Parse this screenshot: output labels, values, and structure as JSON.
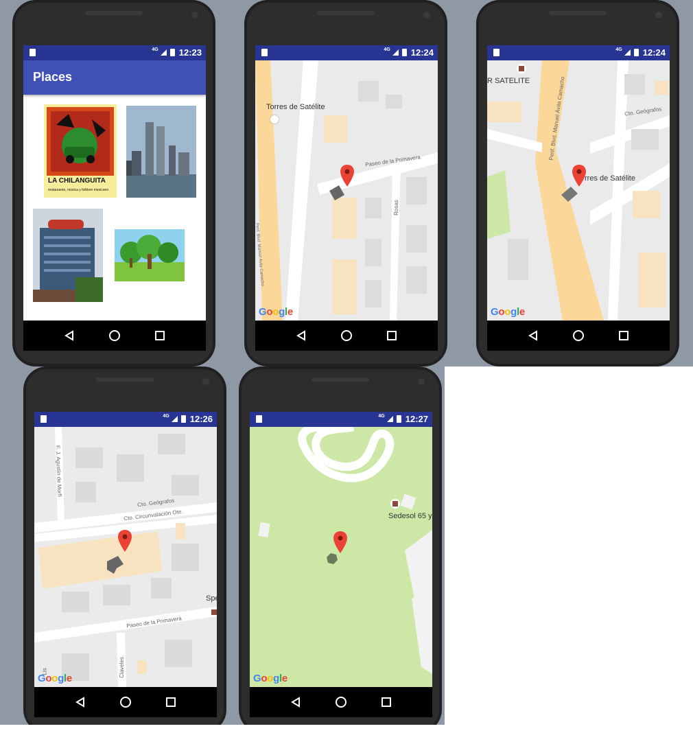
{
  "screens": [
    {
      "time": "12:23",
      "network": "4G",
      "app_title": "Places"
    },
    {
      "time": "12:24",
      "network": "4G",
      "map_labels": {
        "poi": "Torres de Satélite",
        "street1": "Paseo de la Primavera",
        "street2": "Rosas",
        "street3": "Perif. Blvd. Manuel Ávila Camacho"
      }
    },
    {
      "time": "12:24",
      "network": "4G",
      "map_labels": {
        "poi": "rres de Satélite",
        "poi2": "R SATELITE",
        "street1": "Perif. Blvd. Manuel Ávila Camacho",
        "street2": "Cto. Geógrafos"
      }
    },
    {
      "time": "12:26",
      "network": "4G",
      "map_labels": {
        "street1": "Cto. Geógrafos",
        "street2": "Cto. Circunvalación Ote.",
        "street3": "Paseo de la Primavera",
        "street4": "F. J. Agustín de Morfí",
        "street5": "Claveles",
        "street6": "Lis",
        "poi": "Spe"
      }
    },
    {
      "time": "12:27",
      "network": "4G",
      "map_labels": {
        "poi": "Sedesol 65 y"
      }
    }
  ],
  "thumbnails": {
    "logo_text": "LA CHILANGUITA",
    "logo_sub": "restaurante, música y folklore mexicano"
  },
  "google_logo": "Google",
  "nav_icons": [
    "back-icon",
    "home-icon",
    "recents-icon"
  ],
  "colors": {
    "status_bar": "#283593",
    "app_bar": "#3f51b5",
    "pin": "#ea4335",
    "park": "#cde8a6"
  }
}
